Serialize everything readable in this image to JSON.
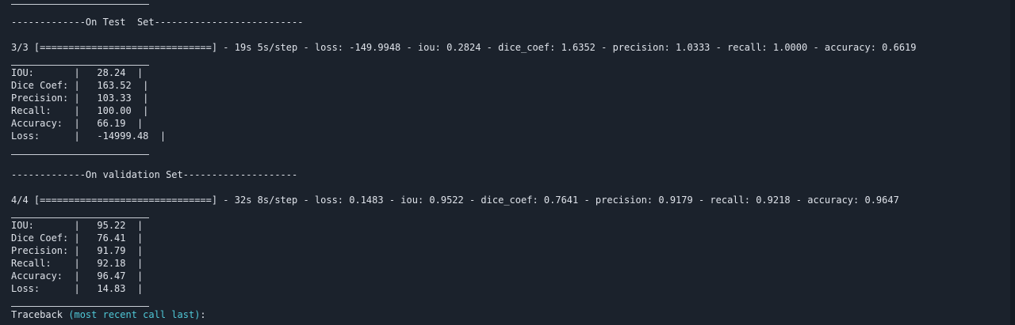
{
  "test": {
    "header": "-------------On Test  Set--------------------------",
    "progress": "3/3 [==============================] - 19s 5s/step - loss: -149.9948 - iou: 0.2824 - dice_coef: 1.6352 - precision: 1.0333 - recall: 1.0000 - accuracy: 0.6619",
    "rows": [
      "IOU:       |   28.24  |",
      "Dice Coef: |   163.52  |",
      "Precision: |   103.33  |",
      "Recall:    |   100.00  |",
      "Accuracy:  |   66.19  |",
      "Loss:      |   -14999.48  |"
    ]
  },
  "validation": {
    "header": "-------------On validation Set--------------------",
    "progress": "4/4 [==============================] - 32s 8s/step - loss: 0.1483 - iou: 0.9522 - dice_coef: 0.7641 - precision: 0.9179 - recall: 0.9218 - accuracy: 0.9647",
    "rows": [
      "IOU:       |   95.22  |",
      "Dice Coef: |   76.41  |",
      "Precision: |   91.79  |",
      "Recall:    |   92.18  |",
      "Accuracy:  |   96.47  |",
      "Loss:      |   14.83  |"
    ]
  },
  "traceback": {
    "label": "Traceback ",
    "detail": "(most recent call last)",
    "suffix": ":"
  },
  "colors": {
    "background": "#1b222c",
    "text": "#dfe3ea",
    "accent_cyan": "#4fc7d6"
  }
}
